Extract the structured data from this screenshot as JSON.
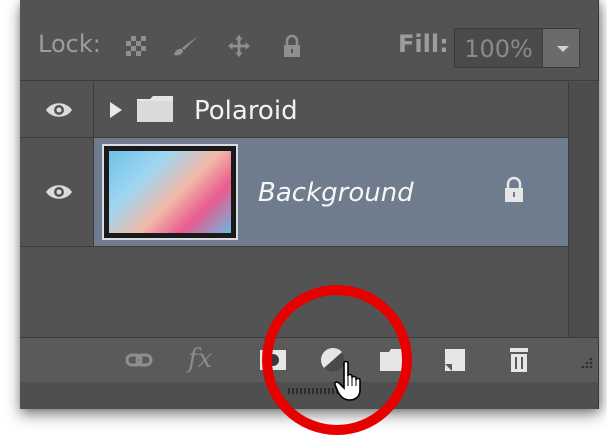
{
  "lock_row": {
    "lock_label": "Lock:",
    "lock_icons": [
      "transparent-pixels-lock-icon",
      "brush-lock-icon",
      "move-lock-icon",
      "padlock-icon"
    ],
    "fill_label": "Fill:",
    "fill_value": "100%"
  },
  "layers": [
    {
      "name": "Polaroid",
      "type": "group",
      "visible": true,
      "expanded": false
    },
    {
      "name": "Background",
      "type": "image",
      "visible": true,
      "locked": true,
      "selected": true
    }
  ],
  "toolbar": {
    "icons": [
      "link-icon",
      "fx-icon",
      "layer-mask-icon",
      "adjustment-layer-icon",
      "new-group-icon",
      "new-layer-icon",
      "trash-icon"
    ],
    "fx_label": "fx"
  },
  "colors": {
    "panel_bg": "#535353",
    "selected_row": "#6e7c8e",
    "highlight": "#e60000"
  }
}
